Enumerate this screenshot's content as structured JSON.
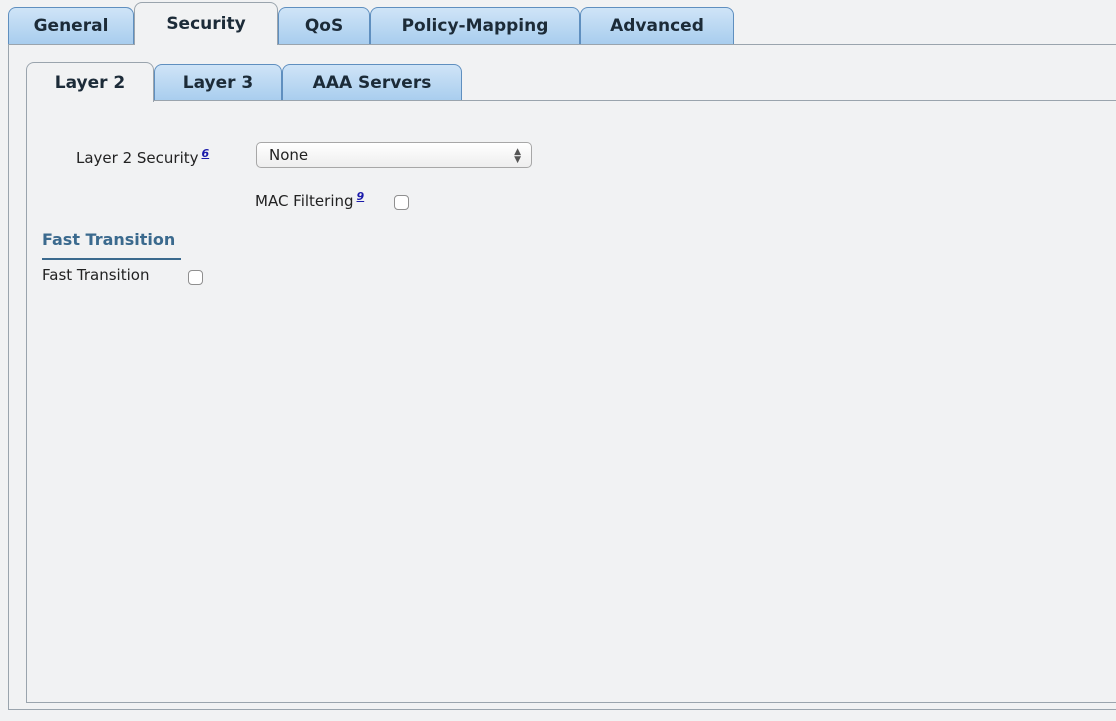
{
  "tabs": [
    {
      "label": "General"
    },
    {
      "label": "Security",
      "active": true
    },
    {
      "label": "QoS"
    },
    {
      "label": "Policy-Mapping"
    },
    {
      "label": "Advanced"
    }
  ],
  "sub_tabs": [
    {
      "label": "Layer 2",
      "active": true
    },
    {
      "label": "Layer 3"
    },
    {
      "label": "AAA Servers"
    }
  ],
  "layer2": {
    "security_label": "Layer 2 Security",
    "security_footnote": "6",
    "security_value": "None",
    "mac_filtering_label": "MAC Filtering",
    "mac_filtering_footnote": "9",
    "mac_filtering_checked": false
  },
  "fast_transition": {
    "section_title": "Fast Transition",
    "label": "Fast Transition",
    "checked": false
  },
  "colors": {
    "tab_fill": "#a8cdee",
    "tab_border": "#5f8fbf",
    "section_title": "#3b6a8e",
    "footnote_link": "#1a1aaa"
  },
  "icons": {
    "select_arrows": "updown-arrows-icon"
  }
}
